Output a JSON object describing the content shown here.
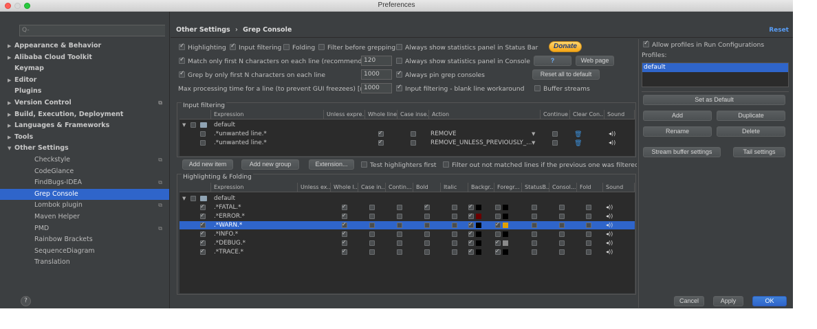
{
  "window": {
    "title": "Preferences"
  },
  "search": {
    "placeholder": "Q-"
  },
  "sidebar": {
    "items": [
      {
        "label": "Appearance & Behavior",
        "arrow": "▶",
        "bold": true
      },
      {
        "label": "Alibaba Cloud Toolkit",
        "arrow": "▶",
        "bold": true
      },
      {
        "label": "Keymap",
        "arrow": "",
        "bold": true
      },
      {
        "label": "Editor",
        "arrow": "▶",
        "bold": true
      },
      {
        "label": "Plugins",
        "arrow": "",
        "bold": true
      },
      {
        "label": "Version Control",
        "arrow": "▶",
        "bold": true,
        "project": true
      },
      {
        "label": "Build, Execution, Deployment",
        "arrow": "▶",
        "bold": true
      },
      {
        "label": "Languages & Frameworks",
        "arrow": "▶",
        "bold": true
      },
      {
        "label": "Tools",
        "arrow": "▶",
        "bold": true
      },
      {
        "label": "Other Settings",
        "arrow": "▼",
        "bold": true
      },
      {
        "label": "Checkstyle",
        "child": true,
        "project": true
      },
      {
        "label": "CodeGlance",
        "child": true
      },
      {
        "label": "FindBugs-IDEA",
        "child": true,
        "project": true
      },
      {
        "label": "Grep Console",
        "child": true,
        "selected": true
      },
      {
        "label": "Lombok plugin",
        "child": true,
        "project": true
      },
      {
        "label": "Maven Helper",
        "child": true
      },
      {
        "label": "PMD",
        "child": true,
        "project": true
      },
      {
        "label": "Rainbow Brackets",
        "child": true
      },
      {
        "label": "SequenceDiagram",
        "child": true
      },
      {
        "label": "Translation",
        "child": true
      }
    ]
  },
  "header": {
    "breadcrumb_parent": "Other Settings",
    "breadcrumb_sep": "›",
    "breadcrumb_current": "Grep Console",
    "reset": "Reset"
  },
  "options": {
    "highlighting": "Highlighting",
    "input_filtering": "Input filtering",
    "folding": "Folding",
    "filter_before_grepping": "Filter before grepping",
    "always_stats_status_bar": "Always show statistics panel in Status Bar",
    "match_first_n": "Match only first N characters on each line (recommended)",
    "match_first_n_value": "120",
    "always_stats_console": "Always show statistics panel in Console",
    "grep_first_n": "Grep by only first N characters on each line",
    "grep_first_n_value": "1000",
    "always_pin": "Always pin grep consoles",
    "max_processing": "Max processing time for a line (to prevent GUI freezees) [ms]",
    "max_processing_value": "1000",
    "blank_line_workaround": "Input filtering - blank line workaround",
    "buffer_streams": "Buffer streams"
  },
  "buttons": {
    "donate": "Donate",
    "help": "?",
    "web_page": "Web page",
    "reset_all": "Reset all to default",
    "add_new_item": "Add new item",
    "add_new_group": "Add new group",
    "extension": "Extension...",
    "set_default": "Set as Default",
    "add": "Add",
    "duplicate": "Duplicate",
    "rename": "Rename",
    "delete": "Delete",
    "stream_buffer": "Stream buffer settings",
    "tail_settings": "Tail settings",
    "cancel": "Cancel",
    "apply": "Apply",
    "ok": "OK"
  },
  "checks_mid": {
    "test_highlighters": "Test highlighters first",
    "filter_out": "Filter out not matched lines if the previous one was filtered o"
  },
  "input_filtering": {
    "title": "Input filtering",
    "headers": [
      "Expression",
      "Unless expre...",
      "Whole line",
      "Case inse...",
      "Action",
      "Continue ...",
      "Clear Con...",
      "Sound"
    ],
    "group": "default",
    "rows": [
      {
        "expression": ".*unwanted line.*",
        "action": "REMOVE"
      },
      {
        "expression": ".*unwanted line.*",
        "action": "REMOVE_UNLESS_PREVIOUSLY_..."
      }
    ]
  },
  "highlighting": {
    "title": "Highlighting & Folding",
    "headers": [
      "Expression",
      "Unless ex...",
      "Whole l...",
      "Case in...",
      "Contin...",
      "Bold",
      "Italic",
      "Backgr...",
      "Foregr...",
      "StatusB...",
      "Consol...",
      "Fold",
      "Sound"
    ],
    "group": "default",
    "rows": [
      {
        "expression": ".*FATAL.*",
        "bold": true,
        "bg": "#000000",
        "fg": "#000000",
        "fg_on": false,
        "selected": false
      },
      {
        "expression": ".*ERROR.*",
        "bold": false,
        "bg": "#6b0000",
        "fg": "#000000",
        "fg_on": false,
        "selected": false
      },
      {
        "expression": ".*WARN.*",
        "bold": false,
        "bg": "#000000",
        "fg": "#e0a000",
        "fg_on": true,
        "selected": true
      },
      {
        "expression": ".*INFO.*",
        "bold": false,
        "bg": "#000000",
        "fg": "#000000",
        "fg_on": false,
        "selected": false
      },
      {
        "expression": ".*DEBUG.*",
        "bold": false,
        "bg": "#000000",
        "fg": "#8a8a8a",
        "fg_on": true,
        "selected": false
      },
      {
        "expression": ".*TRACE.*",
        "bold": false,
        "bg": "#000000",
        "fg": "#000000",
        "fg_on": true,
        "selected": false
      }
    ]
  },
  "profiles": {
    "allow_in_run": "Allow profiles in Run Configurations",
    "label": "Profiles:",
    "items": [
      "default"
    ]
  },
  "icons": {
    "sound": "speaker-icon",
    "clear": "trash-icon",
    "folder": "folder-icon",
    "search": "search-icon"
  }
}
